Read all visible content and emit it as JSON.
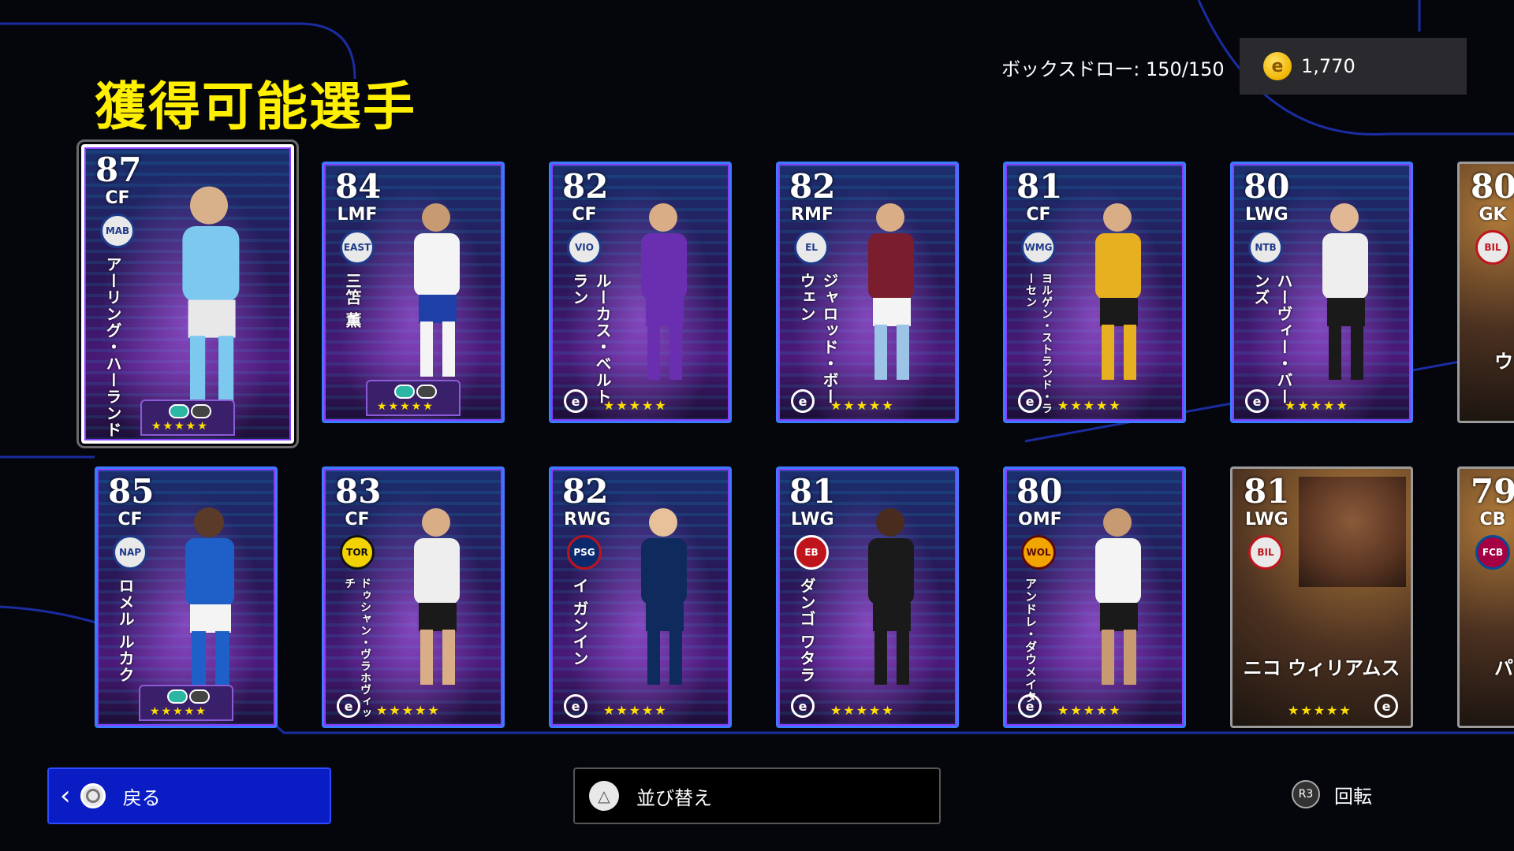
{
  "header": {
    "title": "獲得可能選手",
    "box_draw": "ボックスドロー: 150/150",
    "coins": "1,770"
  },
  "cards": [
    {
      "rating": "87",
      "position": "CF",
      "name": "アーリング・ハーランド",
      "style": "epic",
      "badge": "MAB"
    },
    {
      "rating": "84",
      "position": "LMF",
      "name": "三笘 薫",
      "style": "epic",
      "badge": "EAST"
    },
    {
      "rating": "82",
      "position": "CF",
      "name": "ルーカス・ベルトラン",
      "style": "showtime",
      "badge": "VIO"
    },
    {
      "rating": "82",
      "position": "RMF",
      "name": "ジャロッド・ボーウェン",
      "style": "showtime",
      "badge": "EL"
    },
    {
      "rating": "81",
      "position": "CF",
      "name": "ヨルゲン・ストランド・ラーセン",
      "style": "showtime",
      "badge": "WMG"
    },
    {
      "rating": "80",
      "position": "LWG",
      "name": "ハーヴィー・バーンズ",
      "style": "showtime",
      "badge": "NTB"
    },
    {
      "rating": "80",
      "position": "GK",
      "name": "ウ",
      "style": "gold",
      "badge": "BIL"
    },
    {
      "rating": "85",
      "position": "CF",
      "name": "ロメル ルカク",
      "style": "epic",
      "badge": "NAP"
    },
    {
      "rating": "83",
      "position": "CF",
      "name": "ドゥシャン・ヴラホヴィッチ",
      "style": "showtime",
      "badge": "TOR"
    },
    {
      "rating": "82",
      "position": "RWG",
      "name": "イ ガンイン",
      "style": "showtime",
      "badge": "PSG"
    },
    {
      "rating": "81",
      "position": "LWG",
      "name": "ダンゴ ワタラ",
      "style": "showtime",
      "badge": "EB"
    },
    {
      "rating": "80",
      "position": "OMF",
      "name": "アンドレ・ダウメイタ",
      "style": "showtime",
      "badge": "WOL"
    },
    {
      "rating": "81",
      "position": "LWG",
      "name": "ニコ ウィリアムス",
      "style": "gold",
      "badge": "BIL"
    },
    {
      "rating": "79",
      "position": "CB",
      "name": "パ",
      "style": "gold",
      "badge": "FCB"
    }
  ],
  "buttons": {
    "back": "戻る",
    "sort": "並び替え",
    "rotate_key": "R3",
    "rotate": "回転"
  },
  "stars": "★★★★★",
  "colors": {
    "title": "#ffef00",
    "back_button": "#0a1cc4",
    "card_border": "#3a7bff"
  },
  "icons": {
    "coin": "coin-icon",
    "back": "circle-button-icon",
    "sort": "triangle-button-icon",
    "rotate": "r3-stick-icon"
  }
}
